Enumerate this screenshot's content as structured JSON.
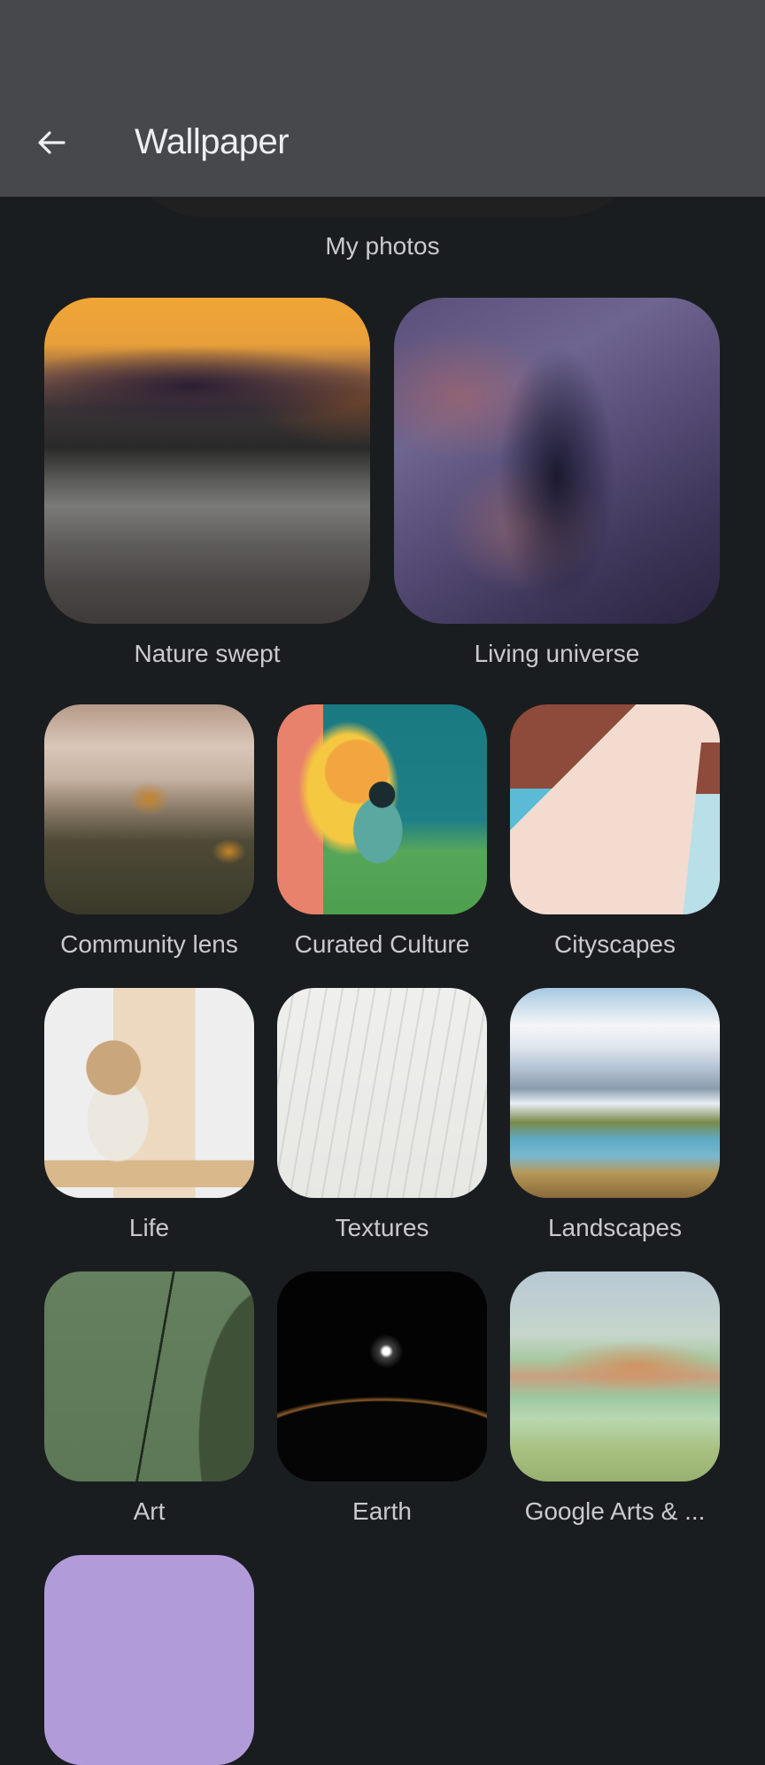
{
  "app_bar": {
    "title": "Wallpaper",
    "back_icon": "arrow-back-icon",
    "background_color": "#47484c"
  },
  "my_photos": {
    "label": "My photos"
  },
  "featured": [
    {
      "label": "Nature swept",
      "art": "blurred-sunset"
    },
    {
      "label": "Living universe",
      "art": "purple-rock-canyon"
    }
  ],
  "categories": [
    {
      "label": "Community lens",
      "art": "misty-forest"
    },
    {
      "label": "Curated Culture",
      "art": "illustrated-figure"
    },
    {
      "label": "Cityscapes",
      "art": "pink-architecture"
    },
    {
      "label": "Life",
      "art": "stone-arch-still-life"
    },
    {
      "label": "Textures",
      "art": "white-feathers"
    },
    {
      "label": "Landscapes",
      "art": "mountain-lake"
    },
    {
      "label": "Art",
      "art": "green-curves"
    },
    {
      "label": "Earth",
      "art": "planet-horizon"
    },
    {
      "label": "Google Arts & ...",
      "art": "pointillist-village"
    },
    {
      "label": "",
      "art": "solid-purple",
      "color": "#b19cd9"
    }
  ],
  "colors": {
    "background": "#1a1d20",
    "label_text": "#c8cad0",
    "title_text": "#eceff3"
  }
}
